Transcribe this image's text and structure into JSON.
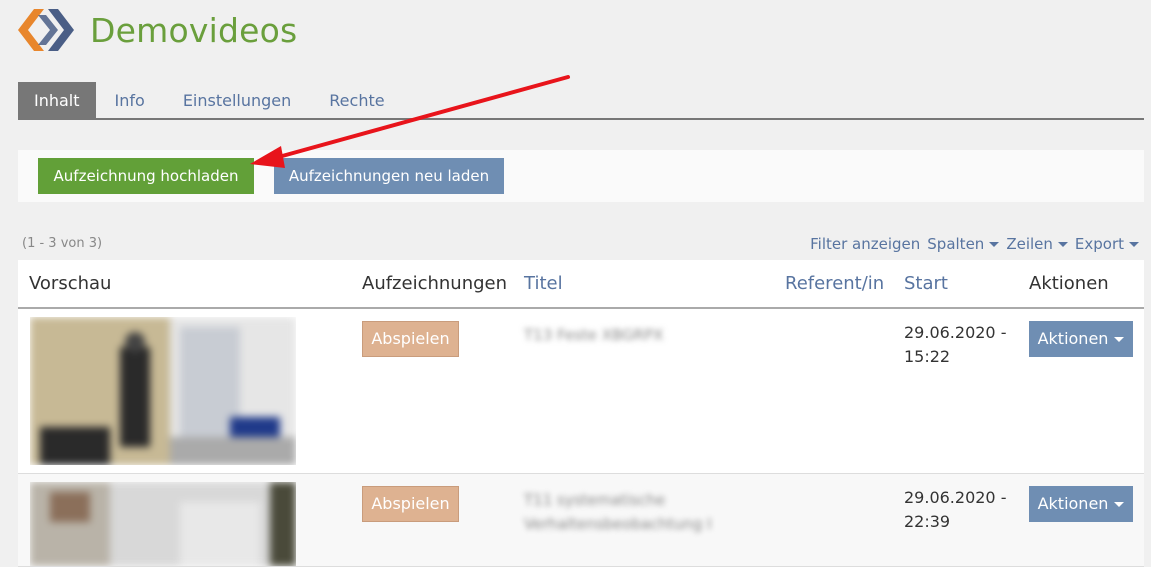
{
  "header": {
    "title": "Demovideos",
    "logo_icon": "diamond-chevron-logo"
  },
  "tabs": [
    {
      "label": "Inhalt",
      "active": true
    },
    {
      "label": "Info"
    },
    {
      "label": "Einstellungen"
    },
    {
      "label": "Rechte"
    }
  ],
  "toolbar": {
    "upload_label": "Aufzeichnung hochladen",
    "reload_label": "Aufzeichnungen neu laden"
  },
  "table_info": {
    "count": "(1 - 3 von 3)"
  },
  "table_tools": {
    "filter": "Filter anzeigen",
    "columns": "Spalten",
    "rows": "Zeilen",
    "export": "Export"
  },
  "columns": {
    "preview": "Vorschau",
    "recordings": "Aufzeichnungen",
    "title": "Titel",
    "speaker": "Referent/in",
    "start": "Start",
    "actions": "Aktionen"
  },
  "rows": [
    {
      "play_label": "Abspielen",
      "title": "T13 Feste XBGRPX",
      "start_date": "29.06.2020 -",
      "start_time": "15:22",
      "actions_label": "Aktionen"
    },
    {
      "play_label": "Abspielen",
      "title": "T11 systematische Verhaltensbeobachtung I",
      "start_date": "29.06.2020 -",
      "start_time": "22:39",
      "actions_label": "Aktionen"
    }
  ],
  "colors": {
    "brand_green": "#62a038",
    "title_green": "#6a9f3c",
    "link_blue": "#5874a0",
    "button_blue": "#6f8eb3",
    "play_tan": "#deb291",
    "annotation_red": "#e8141b"
  }
}
